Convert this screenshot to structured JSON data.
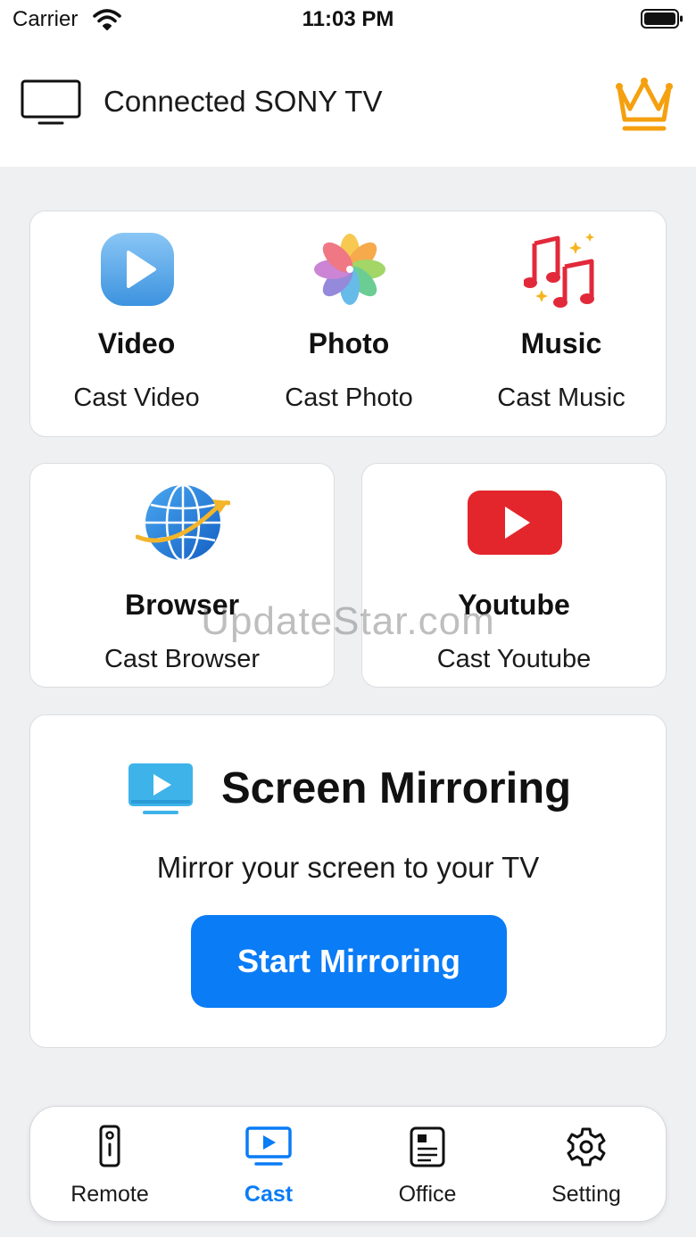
{
  "status_bar": {
    "carrier": "Carrier",
    "time": "11:03 PM"
  },
  "header": {
    "connection_text": "Connected SONY TV"
  },
  "cast_tiles": [
    {
      "title": "Video",
      "subtitle": "Cast Video",
      "icon": "video-play-icon"
    },
    {
      "title": "Photo",
      "subtitle": "Cast Photo",
      "icon": "photos-flower-icon"
    },
    {
      "title": "Music",
      "subtitle": "Cast Music",
      "icon": "music-notes-icon"
    }
  ],
  "browser": {
    "title": "Browser",
    "subtitle": "Cast Browser",
    "icon": "globe-icon"
  },
  "youtube": {
    "title": "Youtube",
    "subtitle": "Cast Youtube",
    "icon": "youtube-icon"
  },
  "mirroring": {
    "title": "Screen Mirroring",
    "subtitle": "Mirror your screen to your TV",
    "button": "Start Mirroring"
  },
  "watermark": "UpdateStar.com",
  "tabs": [
    {
      "label": "Remote",
      "icon": "remote-icon",
      "active": false
    },
    {
      "label": "Cast",
      "icon": "cast-tv-icon",
      "active": true
    },
    {
      "label": "Office",
      "icon": "document-icon",
      "active": false
    },
    {
      "label": "Setting",
      "icon": "gear-icon",
      "active": false
    }
  ],
  "colors": {
    "accent": "#0a7cf6",
    "crown": "#f5a00f",
    "youtube_red": "#e3262b",
    "background": "#eff0f2"
  }
}
